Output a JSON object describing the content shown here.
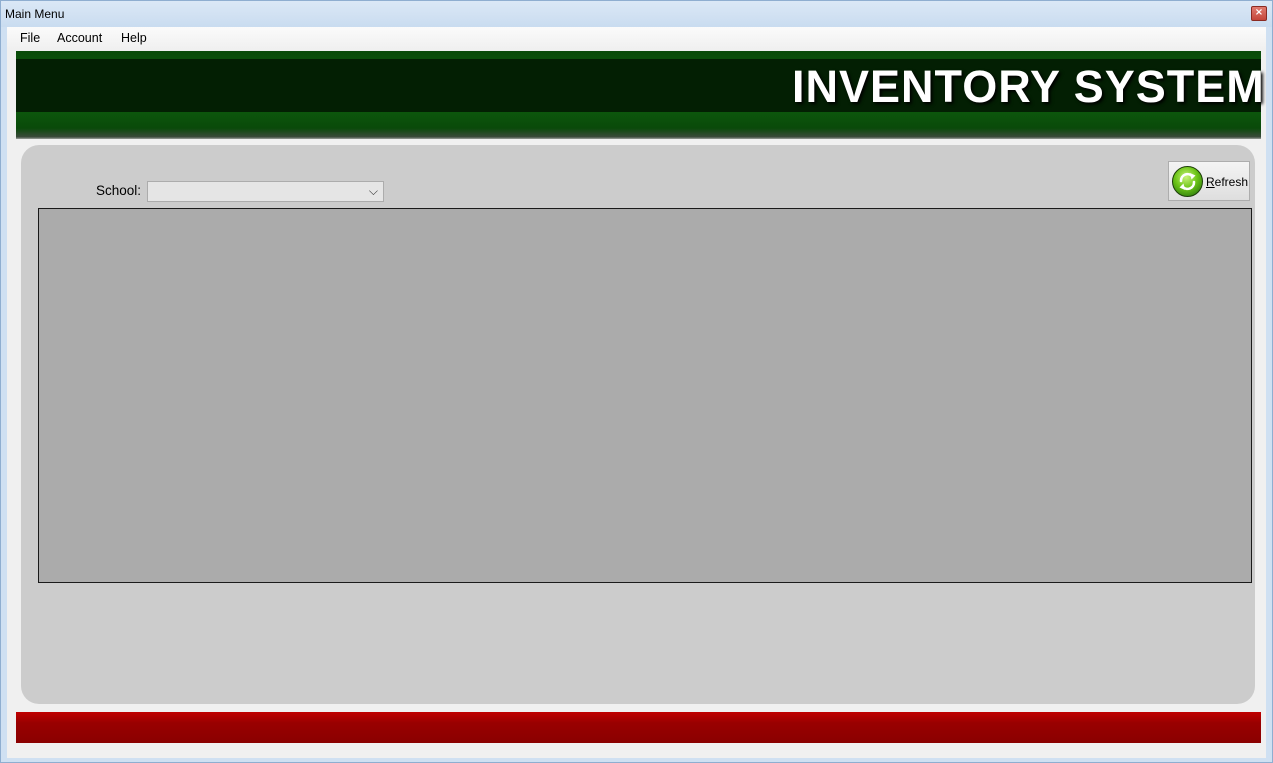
{
  "window": {
    "title": "Main Menu",
    "close_glyph": "×"
  },
  "menubar": {
    "items": [
      {
        "label": "File"
      },
      {
        "label": "Account"
      },
      {
        "label": "Help"
      }
    ]
  },
  "banner": {
    "title": "INVENTORY SYSTEM",
    "colors": {
      "green": "#0b4f0b",
      "dark": "#031f03"
    }
  },
  "filter": {
    "school_label": "School:",
    "school_value": ""
  },
  "toolbar": {
    "refresh_accel": "R",
    "refresh_rest": "efresh",
    "refresh_icon": "refresh-icon"
  },
  "grid": {
    "rows": []
  },
  "footer": {
    "color": "#990000"
  }
}
